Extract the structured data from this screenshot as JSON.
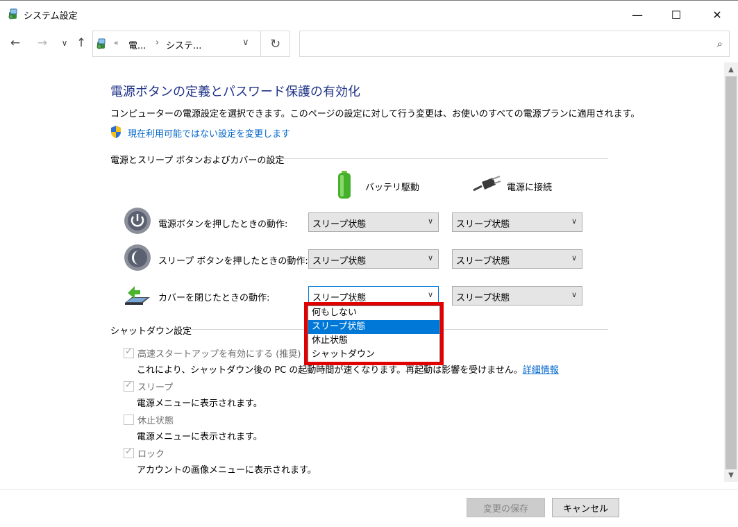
{
  "window": {
    "title": "システム設定",
    "minimize": "—",
    "maximize": "☐",
    "close": "✕"
  },
  "nav": {
    "back": "←",
    "forward": "→",
    "recent": "∨",
    "up": "↑",
    "address": {
      "chevron": "«",
      "crumb1": "電...",
      "separator": "›",
      "crumb2": "システ...",
      "dropdown": "∨"
    },
    "refresh": "↻",
    "search_value": "",
    "search_icon": "⌕"
  },
  "content": {
    "heading": "電源ボタンの定義とパスワード保護の有効化",
    "description": "コンピューターの電源設定を選択できます。このページの設定に対して行う変更は、お使いのすべての電源プランに適用されます。",
    "admin_link": "現在利用可能ではない設定を変更します"
  },
  "power_section": {
    "title": "電源とスリープ ボタンおよびカバーの設定",
    "col_battery": "バッテリ駆動",
    "col_plugged": "電源に接続",
    "rows": [
      {
        "label": "電源ボタンを押したときの動作:",
        "battery": "スリープ状態",
        "plugged": "スリープ状態"
      },
      {
        "label": "スリープ ボタンを押したときの動作:",
        "battery": "スリープ状態",
        "plugged": "スリープ状態"
      },
      {
        "label": "カバーを閉じたときの動作:",
        "battery": "スリープ状態",
        "plugged": "スリープ状態"
      }
    ],
    "dropdown_arrow": "∨"
  },
  "dropdown": {
    "options": [
      "何もしない",
      "スリープ状態",
      "休止状態",
      "シャットダウン"
    ],
    "selected_index": 1
  },
  "shutdown_section": {
    "title": "シャットダウン設定",
    "items": [
      {
        "label": "高速スタートアップを有効にする (推奨)",
        "desc": "これにより、シャットダウン後の PC の起動時間が速くなります。再起動は影響を受けません。",
        "link": "詳細情報",
        "checked": true
      },
      {
        "label": "スリープ",
        "desc": "電源メニューに表示されます。",
        "checked": true
      },
      {
        "label": "休止状態",
        "desc": "電源メニューに表示されます。",
        "checked": false
      },
      {
        "label": "ロック",
        "desc": "アカウントの画像メニューに表示されます。",
        "checked": true
      }
    ],
    "check_glyph": "✓"
  },
  "footer": {
    "save": "変更の保存",
    "cancel": "キャンセル"
  },
  "scrollbar": {
    "up": "▲",
    "down": "▼"
  },
  "colors": {
    "heading": "#1e3287",
    "link": "#0066cc",
    "selection": "#0078d7",
    "highlight_border": "#e00000"
  }
}
